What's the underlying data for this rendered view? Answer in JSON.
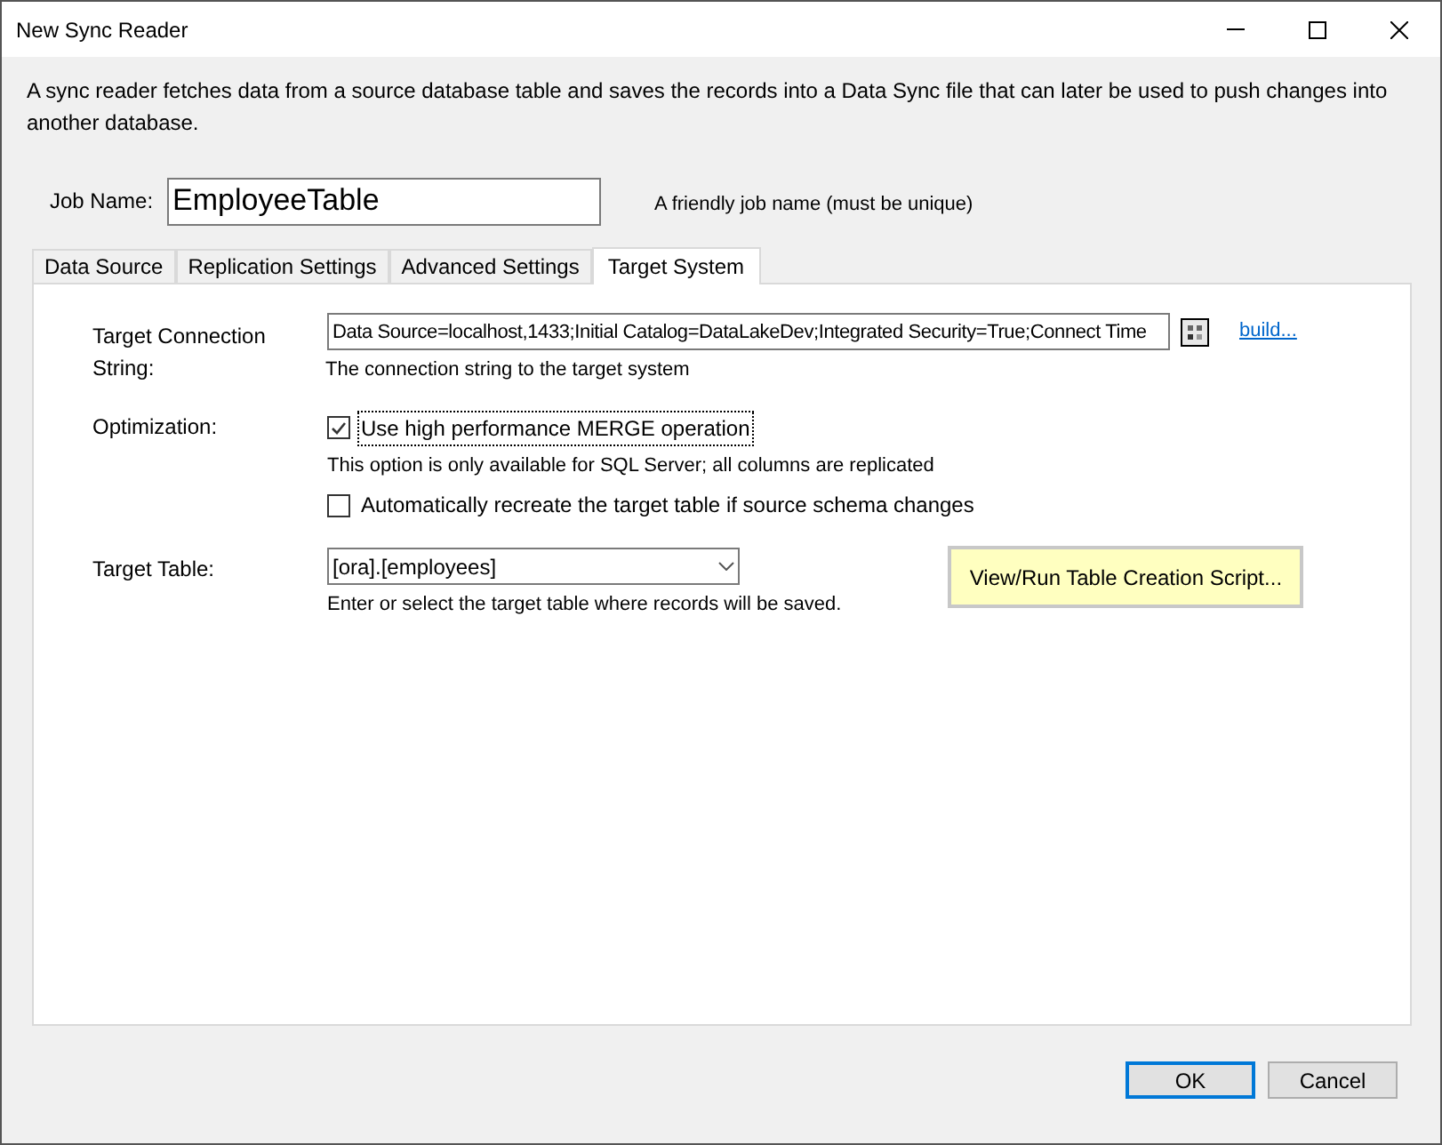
{
  "window": {
    "title": "New Sync Reader"
  },
  "description": "A sync reader fetches data from a source database table and saves the records into a Data Sync file that can later be used to push changes into another database.",
  "job_name": {
    "label": "Job Name:",
    "value": "EmployeeTable",
    "hint": "A friendly job name (must be unique)"
  },
  "tabs": [
    {
      "label": "Data Source",
      "selected": false
    },
    {
      "label": "Replication Settings",
      "selected": false
    },
    {
      "label": "Advanced Settings",
      "selected": false
    },
    {
      "label": "Target System",
      "selected": true
    }
  ],
  "target_connection": {
    "label": "Target Connection String:",
    "value": "Data Source=localhost,1433;Initial Catalog=DataLakeDev;Integrated Security=True;Connect Time",
    "link": "build...",
    "hint": "The connection string to the target system"
  },
  "optimization": {
    "label": "Optimization:",
    "options": [
      {
        "label": "Use high performance MERGE operation",
        "checked": true,
        "focused": true,
        "note": "This option is only available for SQL Server; all columns are replicated"
      },
      {
        "label": "Automatically recreate the target table if source schema changes",
        "checked": false,
        "focused": false
      }
    ]
  },
  "target_table": {
    "label": "Target Table:",
    "value": "[ora].[employees]",
    "hint": "Enter or select the target table where records will be saved.",
    "button": "View/Run Table Creation Script..."
  },
  "buttons": [
    {
      "label": "OK",
      "default": true
    },
    {
      "label": "Cancel",
      "default": false
    }
  ]
}
